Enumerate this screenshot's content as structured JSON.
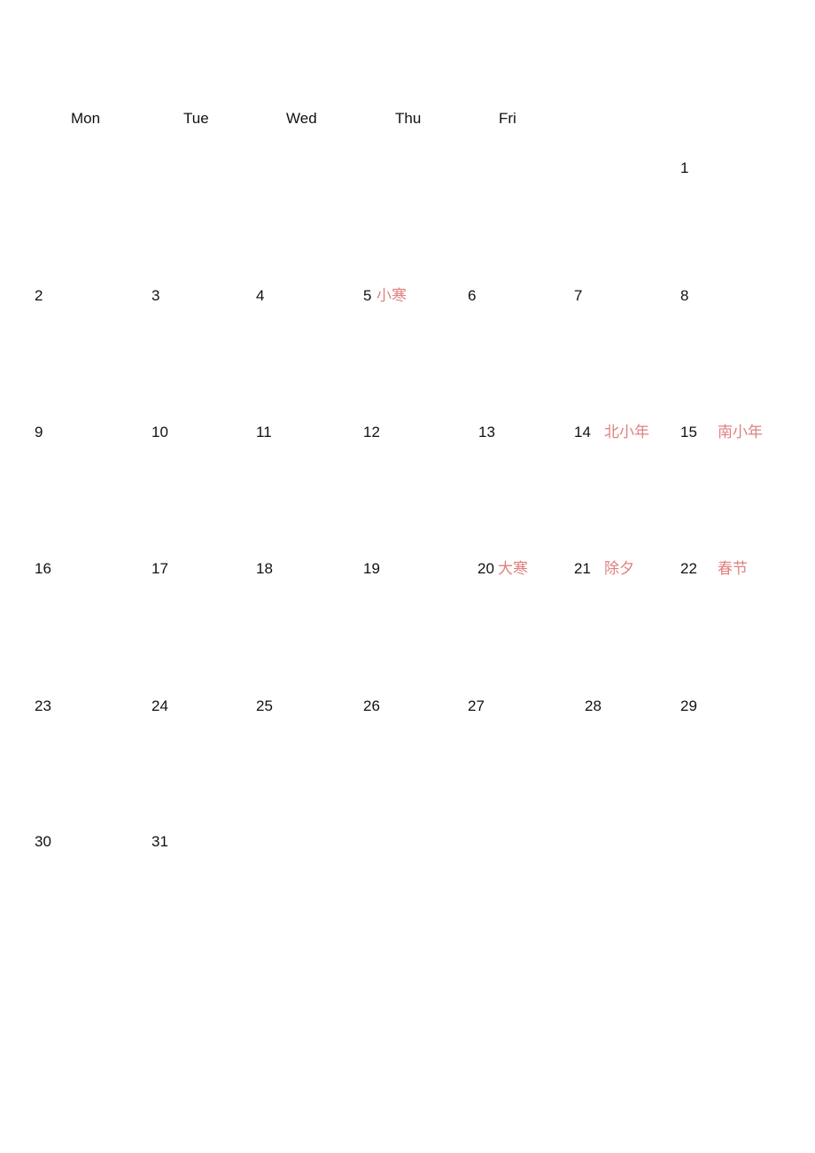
{
  "weekday_headers": [
    "Mon",
    "Tue",
    "Wed",
    "Thu",
    "Fri"
  ],
  "days": {
    "d1": "1",
    "d2": "2",
    "d3": "3",
    "d4": "4",
    "d5": "5",
    "d6": "6",
    "d7": "7",
    "d8": "8",
    "d9": "9",
    "d10": "10",
    "d11": "11",
    "d12": "12",
    "d13": "13",
    "d14": "14",
    "d15": "15",
    "d16": "16",
    "d17": "17",
    "d18": "18",
    "d19": "19",
    "d20": "20",
    "d21": "21",
    "d22": "22",
    "d23": "23",
    "d24": "24",
    "d25": "25",
    "d26": "26",
    "d27": "27",
    "d28": "28",
    "d29": "29",
    "d30": "30",
    "d31": "31"
  },
  "annotations": {
    "d5": "小寒",
    "d14": "北小年",
    "d15": "南小年",
    "d20": "大寒",
    "d21": "除夕",
    "d22": "春节"
  },
  "colors": {
    "text": "#111111",
    "annotation": "#e08080",
    "background": "#ffffff"
  }
}
